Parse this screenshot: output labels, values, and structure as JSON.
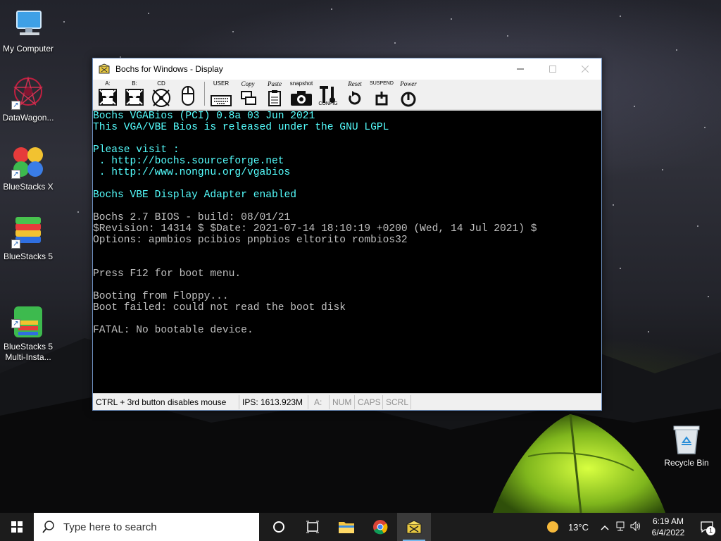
{
  "desktop": {
    "icons": [
      {
        "label": "My Computer"
      },
      {
        "label": "DataWagon..."
      },
      {
        "label": "BlueStacks X"
      },
      {
        "label": "BlueStacks 5"
      },
      {
        "label": "BlueStacks 5\nMulti-Insta..."
      }
    ],
    "recycle_bin": "Recycle Bin"
  },
  "window": {
    "title": "Bochs for Windows - Display",
    "toolbar": {
      "floppy_a": "A:",
      "floppy_b": "B:",
      "cdrom": "CD",
      "user": "USER",
      "copy": "Copy",
      "paste": "Paste",
      "snapshot": "snapshot",
      "config": "CONFIG",
      "reset": "Reset",
      "suspend": "SUSPEND",
      "power": "Power"
    },
    "console": {
      "lines": [
        {
          "text": "Bochs VGABios (PCI) 0.8a 03 Jun 2021",
          "color": "cyan"
        },
        {
          "text": "This VGA/VBE Bios is released under the GNU LGPL",
          "color": "cyan"
        },
        {
          "text": "",
          "color": "cyan"
        },
        {
          "text": "Please visit :",
          "color": "cyan"
        },
        {
          "text": " . http://bochs.sourceforge.net",
          "color": "cyan"
        },
        {
          "text": " . http://www.nongnu.org/vgabios",
          "color": "cyan"
        },
        {
          "text": "",
          "color": "cyan"
        },
        {
          "text": "Bochs VBE Display Adapter enabled",
          "color": "cyan"
        },
        {
          "text": "",
          "color": "gray"
        },
        {
          "text": "Bochs 2.7 BIOS - build: 08/01/21",
          "color": "gray"
        },
        {
          "text": "$Revision: 14314 $ $Date: 2021-07-14 18:10:19 +0200 (Wed, 14 Jul 2021) $",
          "color": "gray"
        },
        {
          "text": "Options: apmbios pcibios pnpbios eltorito rombios32",
          "color": "gray"
        },
        {
          "text": "",
          "color": "gray"
        },
        {
          "text": "",
          "color": "gray"
        },
        {
          "text": "Press F12 for boot menu.",
          "color": "gray"
        },
        {
          "text": "",
          "color": "gray"
        },
        {
          "text": "Booting from Floppy...",
          "color": "gray"
        },
        {
          "text": "Boot failed: could not read the boot disk",
          "color": "gray"
        },
        {
          "text": "",
          "color": "gray"
        },
        {
          "text": "FATAL: No bootable device.",
          "color": "gray"
        }
      ]
    },
    "status": {
      "mouse_hint": "CTRL + 3rd button disables mouse",
      "ips": "IPS: 1613.923M",
      "drive": "A:",
      "num": "NUM",
      "caps": "CAPS",
      "scrl": "SCRL"
    }
  },
  "taskbar": {
    "search_placeholder": "Type here to search",
    "weather": "13°C",
    "time": "6:19 AM",
    "date": "6/4/2022",
    "notification_count": "1"
  },
  "colors": {
    "console_cyan": "#55ffff",
    "console_gray": "#c0c0c0",
    "taskbar_accent": "#76b9ed"
  }
}
